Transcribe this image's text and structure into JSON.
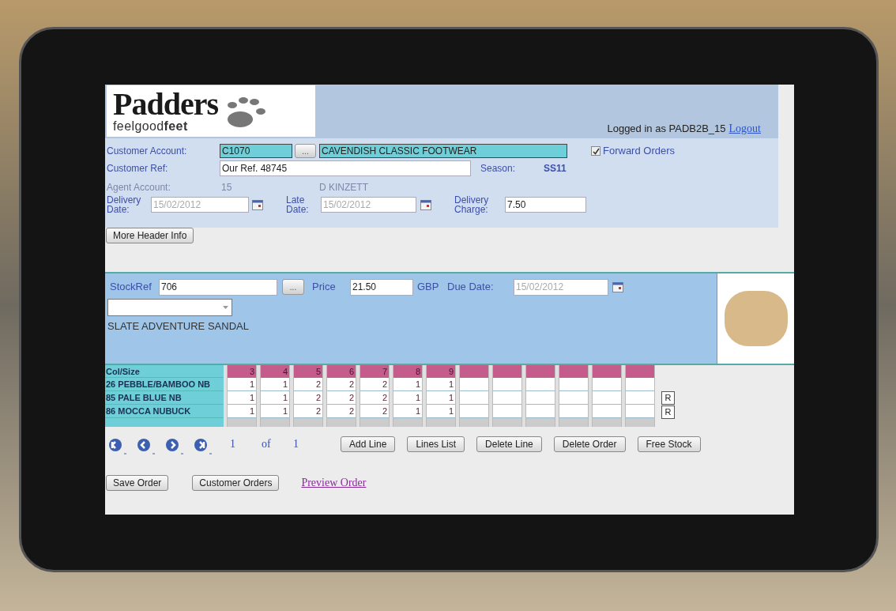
{
  "header": {
    "logo_name": "Padders",
    "logo_tagline": "feelgood**feet**",
    "logged_in": "Logged in as PADB2B_15",
    "logout": "Logout"
  },
  "form": {
    "customer_account": {
      "label": "Customer Account:",
      "code": "C1070",
      "lookup": "...",
      "name": "CAVENDISH CLASSIC FOOTWEAR"
    },
    "forward_orders": {
      "label": "Forward Orders",
      "checked": true
    },
    "customer_ref": {
      "label": "Customer Ref:",
      "value": "Our Ref. 48745"
    },
    "season": {
      "label": "Season:",
      "value": "SS11"
    },
    "agent_account": {
      "label": "Agent Account:",
      "code": "15",
      "name": "D KINZETT"
    },
    "delivery_date": {
      "label": "Delivery Date:",
      "value": "15/02/2012"
    },
    "late_date": {
      "label": "Late Date:",
      "value": "15/02/2012"
    },
    "delivery_charge": {
      "label": "Delivery Charge:",
      "value": "7.50"
    },
    "more_button": "More Header Info"
  },
  "product": {
    "stockref_label": "StockRef",
    "stockref": "706",
    "lookup": "...",
    "price_label": "Price",
    "price": "21.50",
    "currency": "GBP",
    "due_label": "Due Date:",
    "due_date": "15/02/2012",
    "description": "SLATE ADVENTURE SANDAL"
  },
  "grid": {
    "header": "Col/Size",
    "columns": [
      {
        "size": "3"
      },
      {
        "size": "4"
      },
      {
        "size": "5"
      },
      {
        "size": "6"
      },
      {
        "size": "7"
      },
      {
        "size": "8"
      },
      {
        "size": "9"
      },
      {},
      {},
      {},
      {},
      {},
      {}
    ],
    "rows": [
      {
        "colour": "26 PEBBLE/BAMBOO NB",
        "quantities": [
          "1",
          "1",
          "2",
          "2",
          "2",
          "1",
          "1"
        ]
      },
      {
        "colour": "85 PALE BLUE NB",
        "quantities": [
          "1",
          "1",
          "2",
          "2",
          "2",
          "1",
          "1"
        ],
        "reset": "R"
      },
      {
        "colour": "86 MOCCA NUBUCK",
        "quantities": [
          "1",
          "1",
          "2",
          "2",
          "2",
          "1",
          "1"
        ],
        "reset": "R"
      }
    ]
  },
  "pager": {
    "page": "1",
    "of": "of",
    "total": "1"
  },
  "line_buttons": [
    "Add Line",
    "Lines List",
    "Delete Line",
    "Delete Order",
    "Free Stock"
  ],
  "bottom": {
    "buttons": [
      "Save Order",
      "Customer Orders"
    ],
    "link": "Preview Order"
  }
}
